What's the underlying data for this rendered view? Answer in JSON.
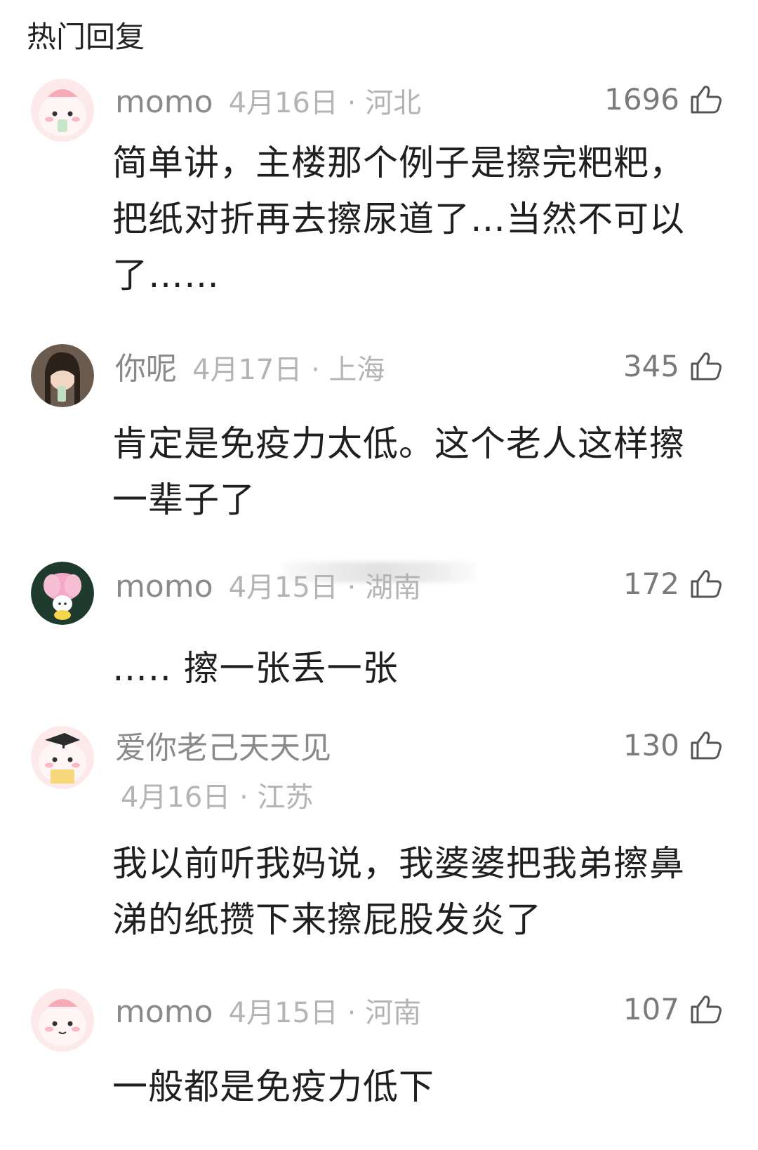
{
  "section_title": "热门回复",
  "comments": [
    {
      "username": "momo",
      "date": "4月16日",
      "location": "河北",
      "likes": "1696",
      "text": "简单讲，主楼那个例子是擦完粑粑，把纸对折再去擦尿道了…当然不可以了……"
    },
    {
      "username": "你呢",
      "date": "4月17日",
      "location": "上海",
      "likes": "345",
      "text": "肯定是免疫力太低。这个老人这样擦一辈子了"
    },
    {
      "username": "momo",
      "date": "4月15日",
      "location": "湖南",
      "likes": "172",
      "text": "….. 擦一张丢一张"
    },
    {
      "username": "爱你老己天天见",
      "date": "4月16日",
      "location": "江苏",
      "likes": "130",
      "text": "我以前听我妈说，我婆婆把我弟擦鼻涕的纸攒下来擦屁股发炎了"
    },
    {
      "username": "momo",
      "date": "4月15日",
      "location": "河南",
      "likes": "107",
      "text": "一般都是免疫力低下"
    }
  ],
  "separator": "·",
  "icons": {
    "like": "thumbs-up-icon",
    "avatar": "avatar-image"
  },
  "colors": {
    "username": "#8a8a8a",
    "meta": "#b4b4b4",
    "text": "#1f1f1f"
  }
}
